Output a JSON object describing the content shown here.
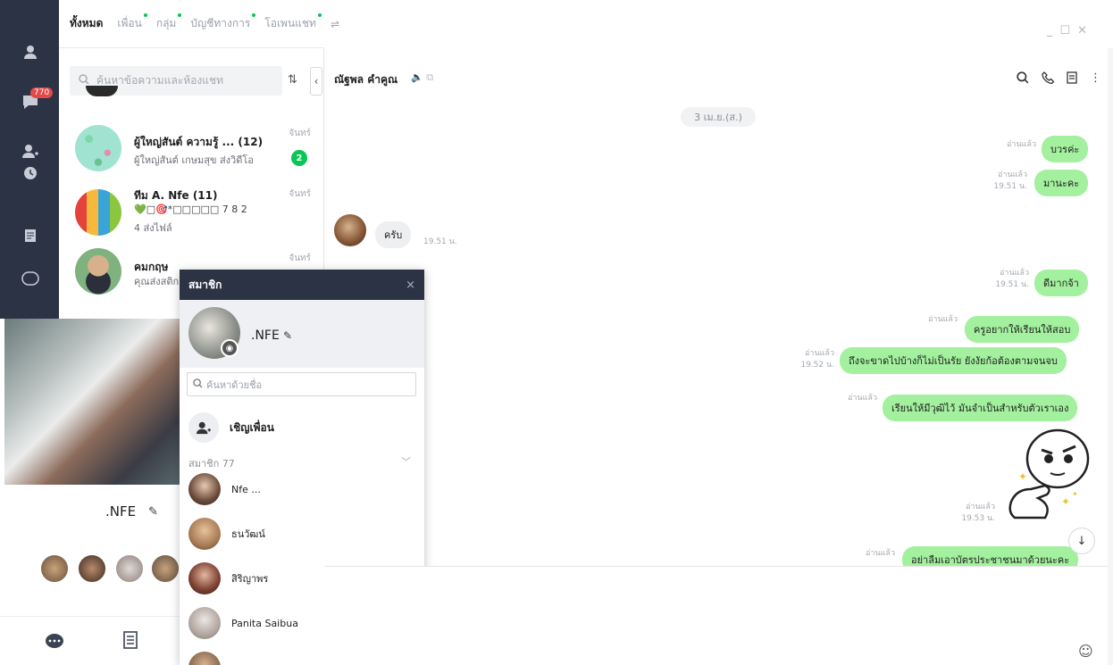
{
  "rail": {
    "badge": "770"
  },
  "tabs": [
    {
      "label": "ทั้งหมด"
    },
    {
      "label": "เพื่อน"
    },
    {
      "label": "กลุ่ม"
    },
    {
      "label": "บัญชีทางการ"
    },
    {
      "label": "โอเพนแชท"
    }
  ],
  "search": {
    "placeholder": "ค้นหาข้อความและห้องแชท"
  },
  "chats": [
    {
      "name": "ผู้ใหญ่สันต์ ความรู้ ... (12)",
      "preview": "ผู้ใหญ่สันต์ เกษมสุข ส่งวิดีโอ",
      "time": "จันทร์",
      "unread": "2"
    },
    {
      "name": "ทีม A.  Nfe (11)",
      "preview": "💚□🎯*□□□□□ 7 8 2",
      "preview2": "4 ส่งไฟล์",
      "time": "จันทร์"
    },
    {
      "name": "คมกฤษ",
      "preview": "คุณส่งสติกเ...",
      "time": "จันทร์"
    }
  ],
  "profile": {
    "name": ".NFE"
  },
  "popup": {
    "title": "สมาชิก",
    "close": "×",
    "group_name": ".NFE",
    "search_placeholder": "ค้นหาด้วยชื่อ",
    "invite_label": "เชิญเพื่อน",
    "members_label": "สมาชิก 77",
    "members": [
      {
        "name": "Nfe ..."
      },
      {
        "name": "ธนวัฒน์"
      },
      {
        "name": "สิริญาพร"
      },
      {
        "name": "Panita Saibua"
      }
    ]
  },
  "room": {
    "title": "ณัฐพล คำคูณ",
    "date": "3 เม.ย.(ส.)",
    "messages": [
      {
        "dir": "out",
        "text": "บวรค่ะ",
        "read": "อ่านแล้ว",
        "time": ""
      },
      {
        "dir": "out",
        "text": "มานะคะ",
        "read": "อ่านแล้ว",
        "time": "19.51 น."
      },
      {
        "dir": "in",
        "text": "ครับ",
        "time": "19.51 น."
      },
      {
        "dir": "out",
        "text": "ดีมากจ้า",
        "read": "อ่านแล้ว",
        "time": "19.51 น."
      },
      {
        "dir": "out",
        "text": "ครูอยากให้เรียนให้สอบ",
        "read": "อ่านแล้ว",
        "time": ""
      },
      {
        "dir": "out",
        "text": "ถึงจะขาดไปบ้างก็ไม่เป็นรัย ยังงัยก้อต้องตามจนจบ",
        "read": "อ่านแล้ว",
        "time": "19.52 น."
      },
      {
        "dir": "out",
        "text": "เรียนให้มีวุฒิไว้ มันจำเป็นสำหรับตัวเราเอง",
        "read": "อ่านแล้ว",
        "time": ""
      },
      {
        "dir": "out",
        "text": "",
        "read": "อ่านแล้ว",
        "time": "19.53 น."
      },
      {
        "dir": "out",
        "text": "อย่าลืมเอาบัตรประชาชนมาด้วยนะคะ",
        "read": "อ่านแล้ว",
        "time": ""
      }
    ]
  },
  "colors": {
    "rail": "#2c3345",
    "bubble_out": "#a3f09f",
    "accent": "#06c755",
    "badge": "#e24a4a"
  }
}
